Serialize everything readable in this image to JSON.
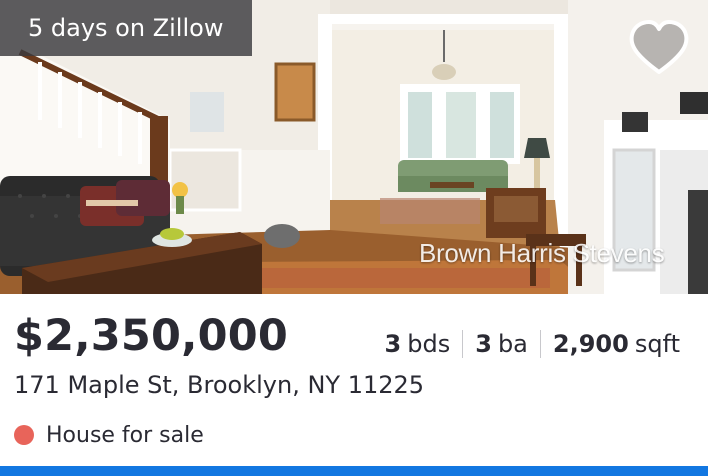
{
  "badge": {
    "text": "5 days on Zillow"
  },
  "favorite": {
    "icon": "heart-outline-icon"
  },
  "photo": {
    "watermark": "Brown Harris Stevens"
  },
  "listing": {
    "price": "$2,350,000",
    "beds": {
      "value": "3",
      "unit": "bds"
    },
    "baths": {
      "value": "3",
      "unit": "ba"
    },
    "sqft": {
      "value": "2,900",
      "unit": "sqft"
    },
    "address": "171 Maple St, Brooklyn, NY 11225",
    "status": {
      "label": "House for sale",
      "color": "#e8645a"
    }
  },
  "theme": {
    "accent": "#1277e1",
    "text": "#2a2a33"
  }
}
